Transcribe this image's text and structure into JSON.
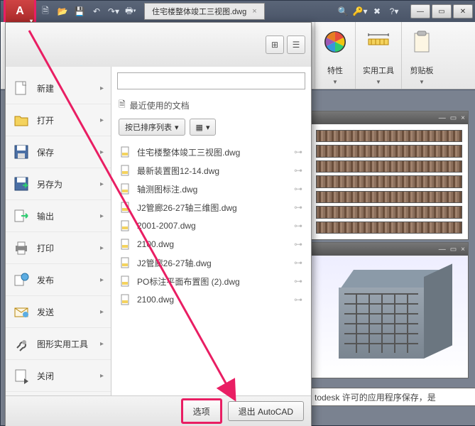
{
  "title_tab": {
    "label": "住宅楼整体竣工三视图.dwg"
  },
  "ribbon": {
    "panel_props": {
      "label": "特性"
    },
    "panel_tools": {
      "label": "实用工具"
    },
    "panel_clip": {
      "label": "剪贴板"
    }
  },
  "app_menu": {
    "left": [
      {
        "label": "新建",
        "icon": "new"
      },
      {
        "label": "打开",
        "icon": "open"
      },
      {
        "label": "保存",
        "icon": "save"
      },
      {
        "label": "另存为",
        "icon": "saveas"
      },
      {
        "label": "输出",
        "icon": "export"
      },
      {
        "label": "打印",
        "icon": "print"
      },
      {
        "label": "发布",
        "icon": "publish"
      },
      {
        "label": "发送",
        "icon": "send"
      },
      {
        "label": "图形实用工具",
        "icon": "dwgutil"
      },
      {
        "label": "关闭",
        "icon": "close"
      }
    ],
    "recent_header": "最近使用的文档",
    "sort_label": "按已排序列表",
    "search": {
      "placeholder": ""
    },
    "recent": [
      "住宅楼整体竣工三视图.dwg",
      "最新装置图12-14.dwg",
      "轴测图标注.dwg",
      "J2管廊26-27轴三维图.dwg",
      "2001-2007.dwg",
      "2100.dwg",
      "J2管廊26-27轴.dwg",
      "PO标注平面布置图 (2).dwg",
      "2100.dwg"
    ],
    "footer": {
      "options": "选项",
      "exit": "退出 AutoCAD"
    }
  },
  "license_text": "todesk 许可的应用程序保存，是"
}
